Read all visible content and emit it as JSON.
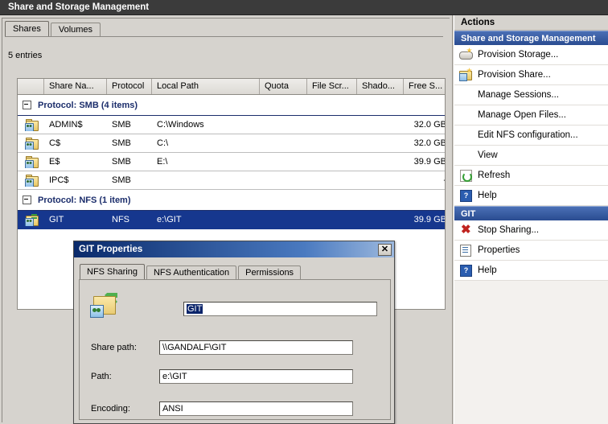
{
  "window": {
    "title": "Share and Storage Management"
  },
  "tabs": [
    {
      "label": "Shares",
      "active": true
    },
    {
      "label": "Volumes",
      "active": false
    }
  ],
  "list": {
    "entries_label": "5 entries",
    "columns": [
      {
        "key": "icon",
        "label": ""
      },
      {
        "key": "name",
        "label": "Share Na..."
      },
      {
        "key": "protocol",
        "label": "Protocol"
      },
      {
        "key": "local_path",
        "label": "Local Path"
      },
      {
        "key": "quota",
        "label": "Quota"
      },
      {
        "key": "file_screening",
        "label": "File Scr..."
      },
      {
        "key": "shadow_copies",
        "label": "Shado..."
      },
      {
        "key": "free_space",
        "label": "Free S..."
      },
      {
        "key": "spacer",
        "label": ""
      }
    ],
    "groups": [
      {
        "label": "Protocol: SMB (4 items)",
        "rows": [
          {
            "icon": "smb-share-icon",
            "name": "ADMIN$",
            "protocol": "SMB",
            "local_path": "C:\\Windows",
            "quota": "",
            "file_screening": "",
            "shadow_copies": "",
            "free_space": "32.0 GB",
            "selected": false
          },
          {
            "icon": "smb-share-icon",
            "name": "C$",
            "protocol": "SMB",
            "local_path": "C:\\",
            "quota": "",
            "file_screening": "",
            "shadow_copies": "",
            "free_space": "32.0 GB",
            "selected": false
          },
          {
            "icon": "smb-share-icon",
            "name": "E$",
            "protocol": "SMB",
            "local_path": "E:\\",
            "quota": "",
            "file_screening": "",
            "shadow_copies": "",
            "free_space": "39.9 GB",
            "selected": false
          },
          {
            "icon": "ipc-share-icon",
            "name": "IPC$",
            "protocol": "SMB",
            "local_path": "",
            "quota": "",
            "file_screening": "",
            "shadow_copies": "",
            "free_space": "-",
            "selected": false
          }
        ]
      },
      {
        "label": "Protocol: NFS (1 item)",
        "rows": [
          {
            "icon": "nfs-share-icon",
            "name": "GIT",
            "protocol": "NFS",
            "local_path": "e:\\GIT",
            "quota": "",
            "file_screening": "",
            "shadow_copies": "",
            "free_space": "39.9 GB",
            "selected": true
          }
        ]
      }
    ]
  },
  "actions": {
    "title": "Actions",
    "sections": [
      {
        "header": "Share and Storage Management",
        "items": [
          {
            "label": "Provision Storage...",
            "icon": "provision-storage-icon"
          },
          {
            "label": "Provision Share...",
            "icon": "provision-share-icon"
          },
          {
            "label": "Manage Sessions...",
            "icon": ""
          },
          {
            "label": "Manage Open Files...",
            "icon": ""
          },
          {
            "label": "Edit NFS configuration...",
            "icon": ""
          },
          {
            "label": "View",
            "icon": ""
          },
          {
            "label": "Refresh",
            "icon": "refresh-icon"
          },
          {
            "label": "Help",
            "icon": "help-icon"
          }
        ]
      },
      {
        "header": "GIT",
        "items": [
          {
            "label": "Stop Sharing...",
            "icon": "stop-sharing-icon"
          },
          {
            "label": "Properties",
            "icon": "properties-icon"
          },
          {
            "label": "Help",
            "icon": "help-icon"
          }
        ]
      }
    ]
  },
  "dialog": {
    "title": "GIT Properties",
    "close_label": "✕",
    "tabs": [
      {
        "label": "NFS Sharing",
        "active": true
      },
      {
        "label": "NFS Authentication",
        "active": false
      },
      {
        "label": "Permissions",
        "active": false
      }
    ],
    "share_name": {
      "value": "GIT"
    },
    "fields": [
      {
        "label": "Share path:",
        "value": "\\\\GANDALF\\GIT"
      },
      {
        "label": "Path:",
        "value": "e:\\GIT"
      },
      {
        "label": "Encoding:",
        "value": "ANSI"
      }
    ]
  },
  "colors": {
    "titlebar": "#3b3b3b",
    "selection": "#16378e",
    "group_text": "#1b2d6b",
    "action_section": "#2a4c91",
    "dialog_title": "#0a2a6b",
    "window_face": "#d6d3ce"
  }
}
